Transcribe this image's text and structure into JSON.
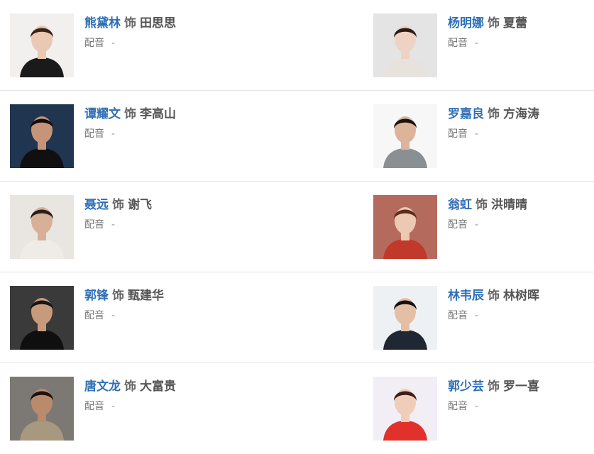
{
  "cast": [
    {
      "left": {
        "actor": "熊黛林",
        "sep": "饰",
        "role": "田思思",
        "dub_label": "配音",
        "dub_value": "-",
        "bg": "#f2f0ee",
        "skin": "#e9c9b4",
        "hair": "#3a2418",
        "cloth": "#1a1a1a"
      },
      "right": {
        "actor": "杨明娜",
        "sep": "饰",
        "role": "夏蕾",
        "dub_label": "配音",
        "dub_value": "-",
        "bg": "#e4e4e4",
        "skin": "#eed3c4",
        "hair": "#2a1c16",
        "cloth": "#e8e2dc"
      }
    },
    {
      "left": {
        "actor": "谭耀文",
        "sep": "饰",
        "role": "李高山",
        "dub_label": "配音",
        "dub_value": "-",
        "bg": "#1f3550",
        "skin": "#c59479",
        "hair": "#120c0a",
        "cloth": "#101010"
      },
      "right": {
        "actor": "罗嘉良",
        "sep": "饰",
        "role": "方海涛",
        "dub_label": "配音",
        "dub_value": "-",
        "bg": "#f7f7f7",
        "skin": "#dcb49a",
        "hair": "#1a1210",
        "cloth": "#8a8f94"
      }
    },
    {
      "left": {
        "actor": "聂远",
        "sep": "饰",
        "role": "谢飞",
        "dub_label": "配音",
        "dub_value": "-",
        "bg": "#e9e6e2",
        "skin": "#d8b097",
        "hair": "#2a1f1a",
        "cloth": "#efece8"
      },
      "right": {
        "actor": "翁虹",
        "sep": "饰",
        "role": "洪晴晴",
        "dub_label": "配音",
        "dub_value": "-",
        "bg": "#b56a5e",
        "skin": "#ecc9b3",
        "hair": "#5a2c1c",
        "cloth": "#c0392b"
      }
    },
    {
      "left": {
        "actor": "郭锋",
        "sep": "饰",
        "role": "甄建华",
        "dub_label": "配音",
        "dub_value": "-",
        "bg": "#3a3a3a",
        "skin": "#c89a7c",
        "hair": "#151515",
        "cloth": "#0f0f0f"
      },
      "right": {
        "actor": "林韦辰",
        "sep": "饰",
        "role": "林树晖",
        "dub_label": "配音",
        "dub_value": "-",
        "bg": "#eef1f4",
        "skin": "#e4bfa6",
        "hair": "#141010",
        "cloth": "#1f2733"
      }
    },
    {
      "left": {
        "actor": "唐文龙",
        "sep": "饰",
        "role": "大富贵",
        "dub_label": "配音",
        "dub_value": "-",
        "bg": "#7c7874",
        "skin": "#b98a6c",
        "hair": "#1c1410",
        "cloth": "#a89880"
      },
      "right": {
        "actor": "郭少芸",
        "sep": "饰",
        "role": "罗一喜",
        "dub_label": "配音",
        "dub_value": "-",
        "bg": "#f2eef5",
        "skin": "#f0cdb8",
        "hair": "#3a1e1a",
        "cloth": "#e0312b"
      }
    }
  ]
}
